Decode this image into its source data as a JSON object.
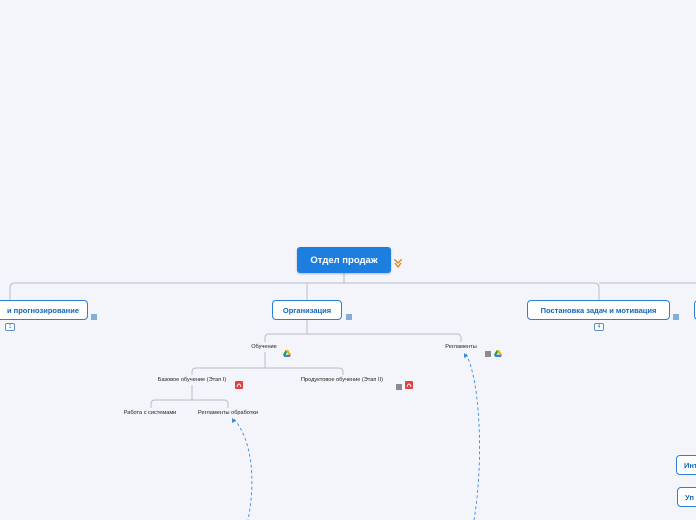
{
  "root": {
    "label": "Отдел продаж"
  },
  "main_topics": {
    "forecast": {
      "label": "и прогнозирование",
      "badge": "1"
    },
    "organization": {
      "label": "Организация"
    },
    "tasks": {
      "label": "Постановка задач и мотивация",
      "badge": "4"
    }
  },
  "subtopics": {
    "training": {
      "label": "Обучение"
    },
    "regulations": {
      "label": "Регламенты"
    },
    "basic_training": {
      "label": "Базовое обучение (Этап I)"
    },
    "product_training": {
      "label": "Продуктовое обучение (Этап II)"
    },
    "systems_work": {
      "label": "Работа с системами"
    },
    "processing_regs": {
      "label": "Регламенты обработки"
    }
  },
  "side_nodes": {
    "int": {
      "label": "Инт"
    },
    "up": {
      "label": "Уп"
    }
  },
  "colors": {
    "background": "#f4f5fb",
    "root_fill": "#1c7fe0",
    "node_border": "#2c7fd6",
    "connector": "#b8bcc8",
    "relation": "#3b8de0",
    "pdf_icon": "#e04040"
  },
  "icons": {
    "root_marker": "down-arrow-marker-icon",
    "notes": "notes-icon",
    "drive": "google-drive-icon",
    "pdf": "pdf-icon"
  }
}
